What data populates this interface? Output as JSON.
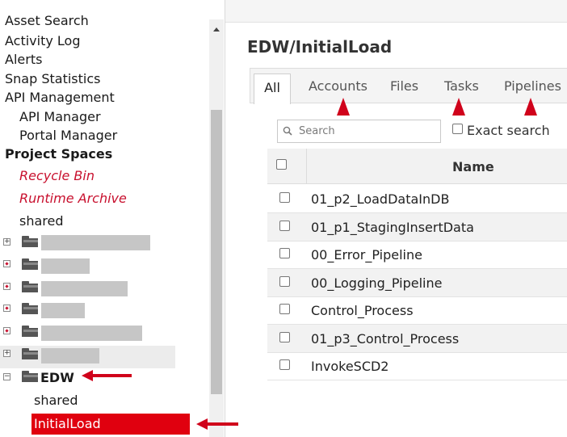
{
  "tree": {
    "items_top": [
      {
        "name": "tree-item-asset-search",
        "label": "Asset Search"
      },
      {
        "name": "tree-item-activity-log",
        "label": "Activity Log"
      },
      {
        "name": "tree-item-alerts",
        "label": "Alerts"
      },
      {
        "name": "tree-item-snap-statistics",
        "label": "Snap Statistics"
      },
      {
        "name": "tree-item-api-management",
        "label": "API Management"
      },
      {
        "name": "tree-item-api-manager",
        "label": "API Manager"
      },
      {
        "name": "tree-item-portal-manager",
        "label": "Portal Manager"
      },
      {
        "name": "tree-item-project-spaces",
        "label": "Project Spaces"
      },
      {
        "name": "tree-item-recycle-bin",
        "label": "Recycle Bin"
      },
      {
        "name": "tree-item-runtime-archive",
        "label": "Runtime Archive"
      },
      {
        "name": "tree-item-shared",
        "label": "shared"
      }
    ],
    "edw_label": "EDW",
    "edw_shared_label": "shared",
    "selected_label": "InitialLoad",
    "expand_collapsed": "+",
    "expand_open": "−"
  },
  "main": {
    "title": "EDW/InitialLoad",
    "tabs": [
      "All",
      "Accounts",
      "Files",
      "Tasks",
      "Pipelines"
    ],
    "search_placeholder": "Search",
    "exact_search_label": "Exact search",
    "column_name": "Name",
    "rows": [
      "01_p2_LoadDataInDB",
      "01_p1_StagingInsertData",
      "00_Error_Pipeline",
      "00_Logging_Pipeline",
      "Control_Process",
      "01_p3_Control_Process",
      "InvokeSCD2"
    ]
  },
  "colors": {
    "accent_red": "#d0021b",
    "selected_bg": "#e0000f",
    "italic_red": "#c8102e"
  },
  "icons": [
    "folder-icon",
    "search-icon",
    "expand-icon",
    "collapse-icon",
    "arrow-icon"
  ]
}
